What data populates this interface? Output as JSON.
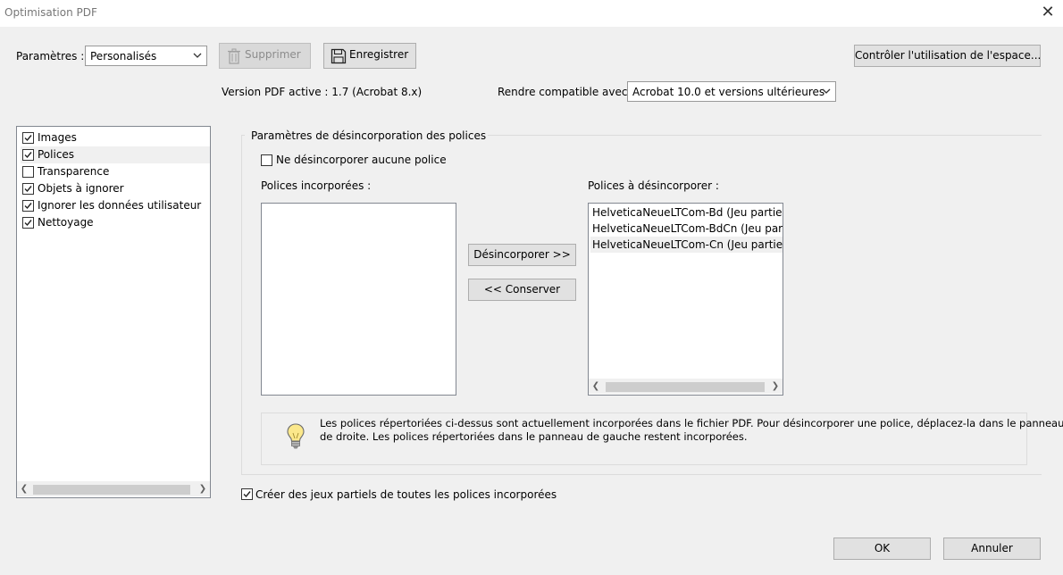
{
  "window": {
    "title": "Optimisation PDF"
  },
  "toolbar": {
    "params_label": "Paramètres :",
    "params_value": "Personalisés",
    "delete_label": "Supprimer",
    "save_label": "Enregistrer",
    "space_usage_label": "Contrôler l'utilisation de l'espace..."
  },
  "version": {
    "active_label": "Version PDF active : 1.7 (Acrobat 8.x)",
    "compat_label": "Rendre compatible avec :",
    "compat_value": "Acrobat 10.0 et versions ultérieures"
  },
  "categories": [
    {
      "label": "Images",
      "checked": true
    },
    {
      "label": "Polices",
      "checked": true,
      "selected": true
    },
    {
      "label": "Transparence",
      "checked": false
    },
    {
      "label": "Objets à ignorer",
      "checked": true
    },
    {
      "label": "Ignorer les données utilisateur",
      "checked": true
    },
    {
      "label": "Nettoyage",
      "checked": true
    }
  ],
  "fonts_panel": {
    "group_title": "Paramètres de désincorporation des polices",
    "no_unembed_label": "Ne désincorporer aucune police",
    "no_unembed_checked": false,
    "embedded_label": "Polices incorporées :",
    "to_unembed_label": "Polices à désincorporer :",
    "unembed_button": "Désincorporer >>",
    "keep_button": "<< Conserver",
    "unembed_list": [
      "HelveticaNeueLTCom-Bd (Jeu partiel)",
      "HelveticaNeueLTCom-BdCn (Jeu partiel)",
      "HelveticaNeueLTCom-Cn (Jeu partiel)"
    ],
    "hint_line1": "Les polices répertoriées ci-dessus sont actuellement incorporées dans le fichier PDF. Pour désincorporer une police, déplacez-la dans le panneau",
    "hint_line2": "de droite. Les polices répertoriées dans le panneau de gauche restent incorporées.",
    "subset_label": "Créer des jeux partiels de toutes les polices incorporées",
    "subset_checked": true
  },
  "footer": {
    "ok_label": "OK",
    "cancel_label": "Annuler"
  },
  "colors": {
    "selected_row": "#f0f0f0",
    "accent": "#0078d7"
  }
}
